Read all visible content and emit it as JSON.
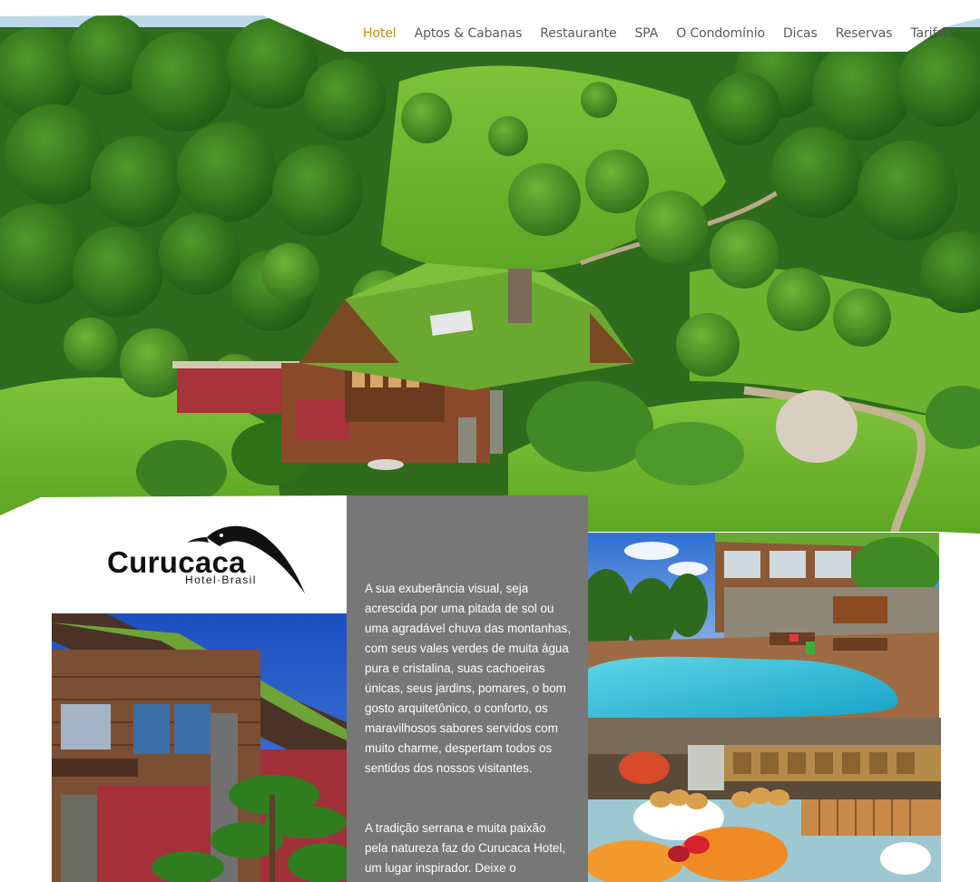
{
  "nav": {
    "items": [
      {
        "label": "Hotel",
        "active": true
      },
      {
        "label": "Aptos & Cabanas",
        "active": false
      },
      {
        "label": "Restaurante",
        "active": false
      },
      {
        "label": "SPA",
        "active": false
      },
      {
        "label": "O Condomínio",
        "active": false
      },
      {
        "label": "Dicas",
        "active": false
      },
      {
        "label": "Reservas",
        "active": false
      },
      {
        "label": "Tarifas",
        "active": false
      }
    ]
  },
  "logo": {
    "wordmark": "Curucaca",
    "subtitle": "Hotel·Brasil"
  },
  "intro": {
    "paragraph1": "A sua exuberância visual, seja acrescida por uma pitada de sol ou uma agradável chuva das montanhas, com seus vales verdes de muita água pura e cristalina, suas cachoeiras únicas, seus jardins, pomares, o bom gosto arquitetônico, o conforto, os maravilhosos sabores servidos com muito charme, despertam todos os sentidos dos nossos visitantes.",
    "paragraph2": "A tradição serrana e muita paixão pela natureza faz do Curucaca Hotel, um lugar inspirador. Deixe o"
  },
  "colors": {
    "accent": "#c98a12",
    "nav_text": "#5a5a5a",
    "panel": "#777777"
  },
  "icons": {
    "logo_bird": "curucaca-bird-icon"
  }
}
